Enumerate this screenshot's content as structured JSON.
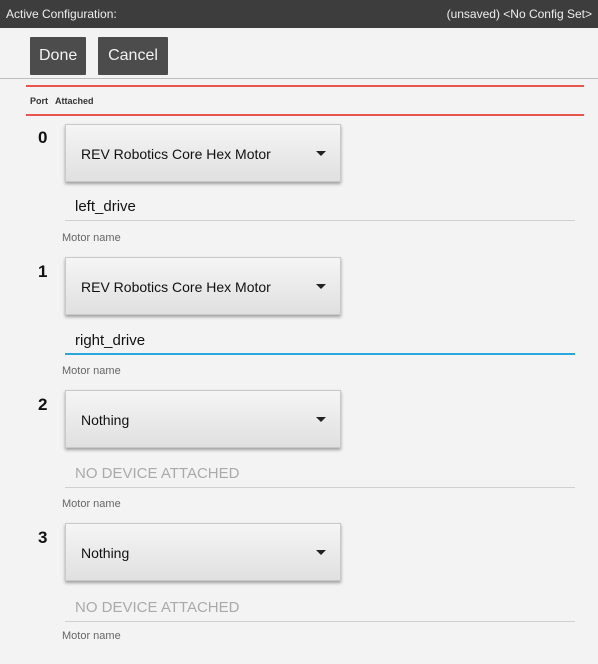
{
  "status_bar": {
    "left": "Active Configuration:",
    "right": "(unsaved) <No Config Set>"
  },
  "toolbar": {
    "done_label": "Done",
    "cancel_label": "Cancel"
  },
  "table_header": {
    "port": "Port",
    "attached": "Attached"
  },
  "ports": [
    {
      "port": "0",
      "device": "REV Robotics Core Hex Motor",
      "name": "left_drive",
      "name_label": "Motor name"
    },
    {
      "port": "1",
      "device": "REV Robotics Core Hex Motor",
      "name": "right_drive",
      "name_label": "Motor name"
    },
    {
      "port": "2",
      "device": "Nothing",
      "name": "NO DEVICE ATTACHED",
      "name_label": "Motor name"
    },
    {
      "port": "3",
      "device": "Nothing",
      "name": "NO DEVICE ATTACHED",
      "name_label": "Motor name"
    }
  ],
  "colors": {
    "accent_red": "#e8554f",
    "focus_blue": "#29a7df"
  }
}
